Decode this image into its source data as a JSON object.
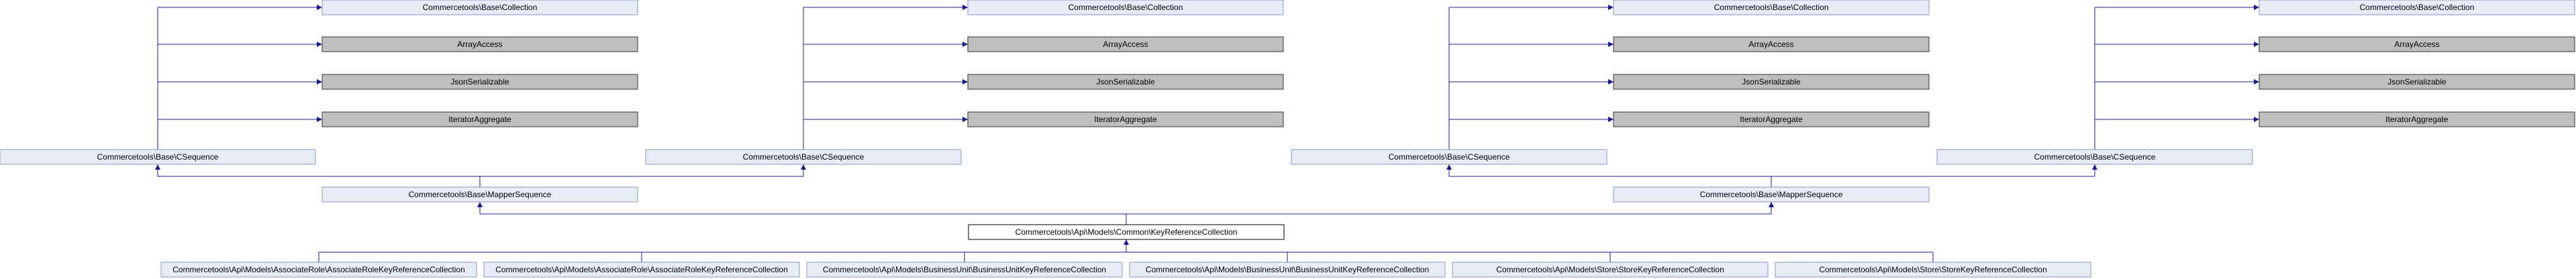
{
  "diagram": {
    "nodes": {
      "collection": "Commercetools\\Base\\Collection",
      "array_access": "ArrayAccess",
      "json_serializable": "JsonSerializable",
      "iterator_aggregate": "IteratorAggregate",
      "csequence": "Commercetools\\Base\\CSequence",
      "mapper_sequence": "Commercetools\\Base\\MapperSequence",
      "key_reference_collection": "Commercetools\\Api\\Models\\Common\\KeyReferenceCollection",
      "associate_role_key_ref": "Commercetools\\Api\\Models\\AssociateRole\\AssociateRoleKeyReferenceCollection",
      "business_unit_key_ref": "Commercetools\\Api\\Models\\BusinessUnit\\BusinessUnitKeyReferenceCollection",
      "store_key_ref": "Commercetools\\Api\\Models\\Store\\StoreKeyReferenceCollection"
    }
  }
}
